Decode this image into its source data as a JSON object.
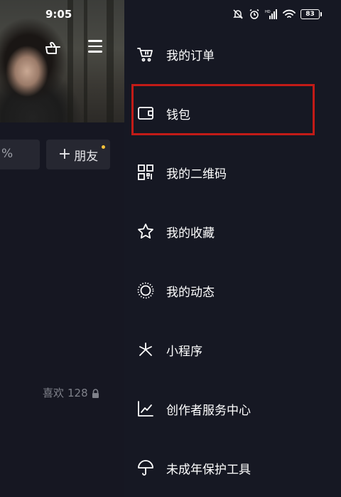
{
  "status_bar": {
    "time": "9:05",
    "battery": "83"
  },
  "profile_background": {
    "stat_fragment": "%",
    "add_friend_label": "朋友",
    "likes_label": "喜欢",
    "likes_count": "128"
  },
  "drawer": {
    "items": [
      {
        "label": "我的订单",
        "icon": "shopping-cart-icon"
      },
      {
        "label": "钱包",
        "icon": "wallet-icon"
      },
      {
        "label": "我的二维码",
        "icon": "qr-code-icon"
      },
      {
        "label": "我的收藏",
        "icon": "star-icon"
      },
      {
        "label": "我的动态",
        "icon": "activity-icon"
      },
      {
        "label": "小程序",
        "icon": "mini-program-icon"
      },
      {
        "label": "创作者服务中心",
        "icon": "chart-icon"
      },
      {
        "label": "未成年保护工具",
        "icon": "umbrella-icon"
      }
    ]
  },
  "colors": {
    "highlight": "#c21b17",
    "background": "#161823"
  }
}
